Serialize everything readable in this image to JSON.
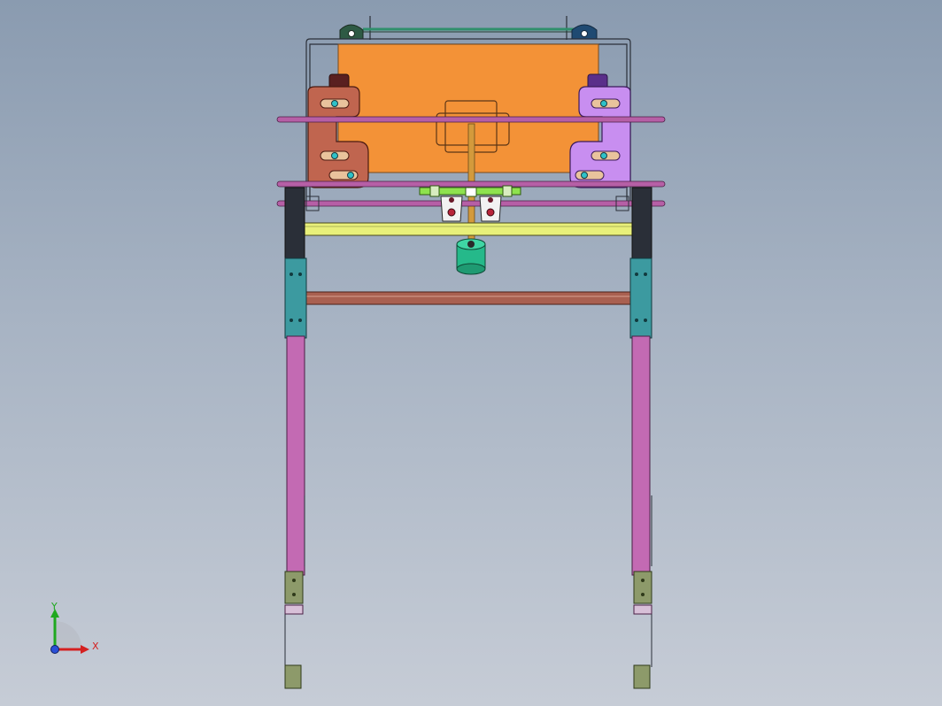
{
  "viewport": {
    "view": "front",
    "background": {
      "top": "#8a9bb0",
      "bottom": "#c6ccd6"
    }
  },
  "triad": {
    "x_label": "X",
    "y_label": "Y",
    "colors": {
      "x": "#d42020",
      "y": "#1fa81f",
      "origin": "#2a4fd6"
    }
  },
  "model_colors": {
    "orange_plate": "#f39237",
    "left_bracket": "#c0654f",
    "right_bracket": "#c88ef0",
    "rods": "#b65fa6",
    "legs": "#c36ab3",
    "leg_blocks": "#3c9aa0",
    "leg_tops": "#2a2f38",
    "yellow_bar": "#e8f07a",
    "brown_bar": "#a96050",
    "green_weight": "#25b98a",
    "feet": "#8d9a6a"
  }
}
